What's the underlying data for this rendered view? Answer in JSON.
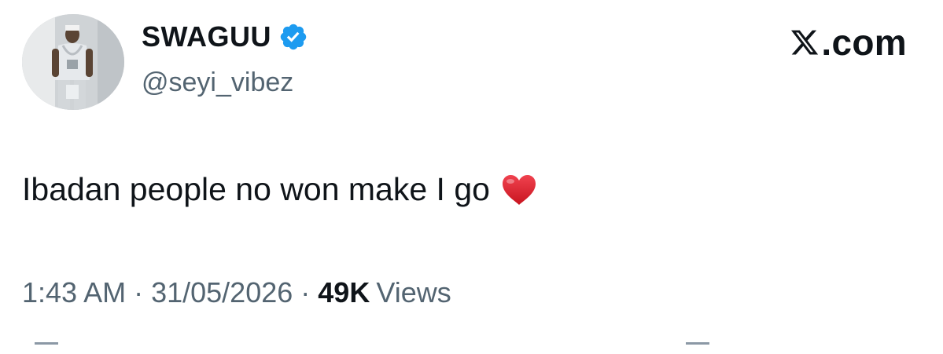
{
  "author": {
    "display_name": "SWAGUU",
    "handle": "@seyi_vibez",
    "verified": true
  },
  "platform": {
    "label": ".com",
    "logo_icon": "x-logo-icon"
  },
  "tweet": {
    "text": "Ibadan people no won make I go",
    "emoji": "heart-emoji"
  },
  "meta": {
    "time": "1:43 AM",
    "separator": "·",
    "date": "31/05/2026",
    "views_count": "49K",
    "views_label": "Views"
  },
  "colors": {
    "primary_text": "#0f1419",
    "secondary_text": "#536471",
    "verified_blue": "#1d9bf0",
    "heart_red": "#e0245e"
  }
}
